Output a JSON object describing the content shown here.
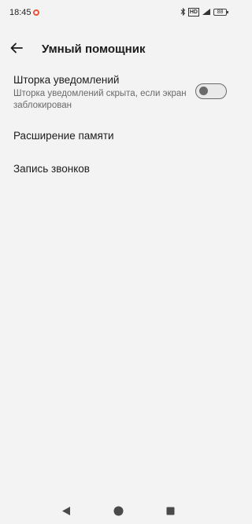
{
  "status_bar": {
    "time": "18:45",
    "notification_icon": "ring-icon",
    "icons": [
      "bluetooth-icon",
      "hd-icon",
      "signal-icon",
      "battery-icon"
    ],
    "hd_label": "HD",
    "battery_level": "88",
    "accent_color": "#e8553a"
  },
  "header": {
    "back_icon": "arrow-left-icon",
    "title": "Умный помощник"
  },
  "settings": [
    {
      "title": "Шторка уведомлений",
      "subtitle": "Шторка уведомлений скрыта, если экран заблокирован",
      "toggle": false
    },
    {
      "title": "Расширение памяти"
    },
    {
      "title": "Запись звонков"
    }
  ],
  "nav_bar": {
    "back": "triangle-back-icon",
    "home": "circle-home-icon",
    "recents": "square-recents-icon"
  }
}
